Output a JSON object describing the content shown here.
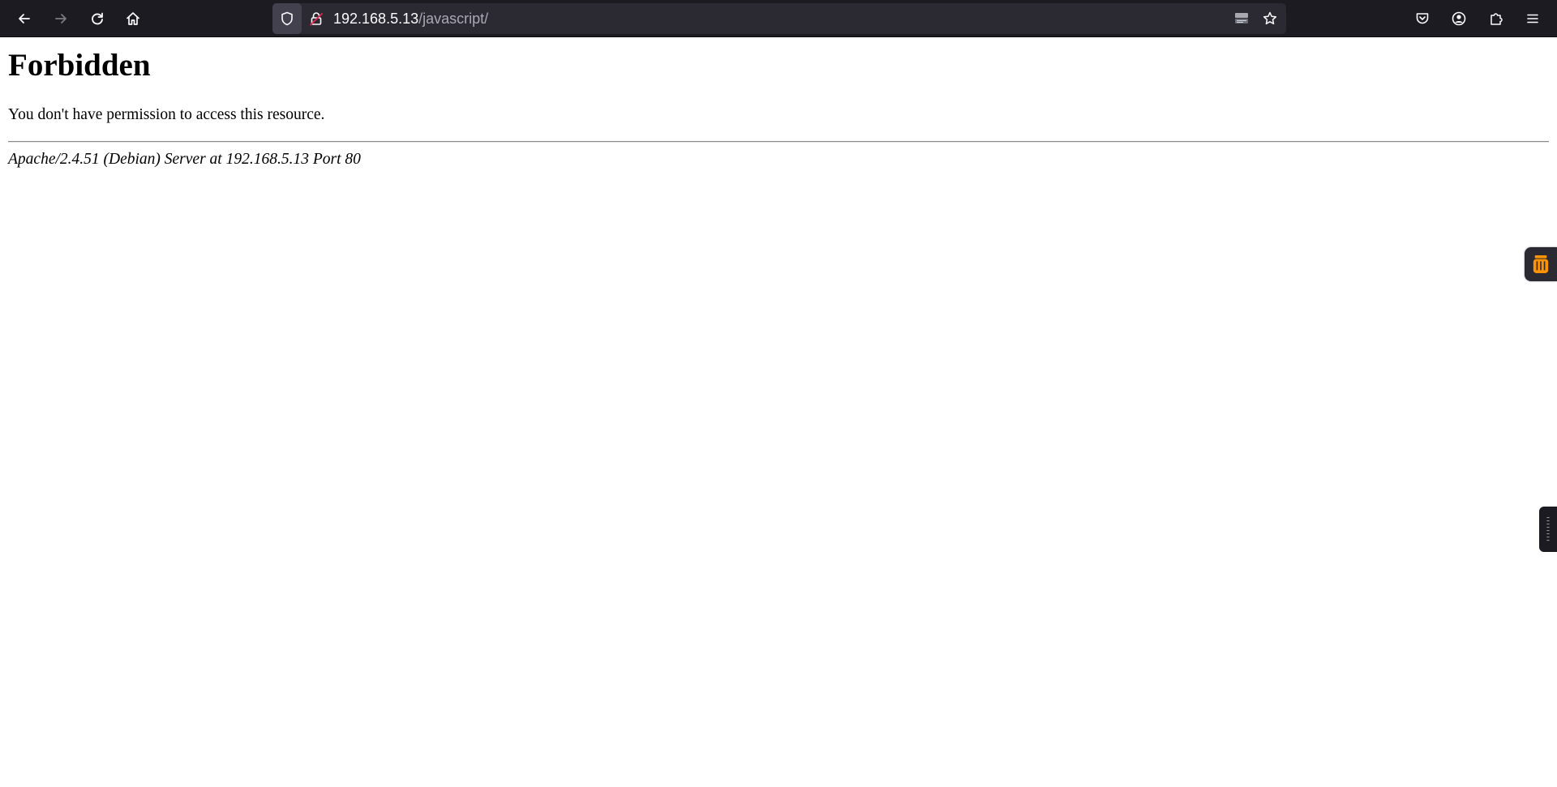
{
  "browser": {
    "url_host": "192.168.5.13",
    "url_path": "/javascript/",
    "icons": {
      "back": "arrow-left-icon",
      "forward": "arrow-right-icon",
      "reload": "reload-icon",
      "home": "home-icon",
      "shield": "shield-icon",
      "lock": "insecure-lock-icon",
      "reader": "reader-view-icon",
      "bookmark": "star-icon",
      "pocket": "pocket-icon",
      "account": "account-icon",
      "extensions": "puzzle-icon",
      "menu": "hamburger-menu-icon"
    },
    "colors": {
      "toolbar_bg": "#1c1b22",
      "urlbar_bg": "#2b2a33",
      "insecure_lock": "#e22850",
      "side_extension_accent": "#ff9400"
    }
  },
  "page": {
    "title": "Forbidden",
    "message": "You don't have permission to access this resource.",
    "address": "Apache/2.4.51 (Debian) Server at 192.168.5.13 Port 80"
  }
}
